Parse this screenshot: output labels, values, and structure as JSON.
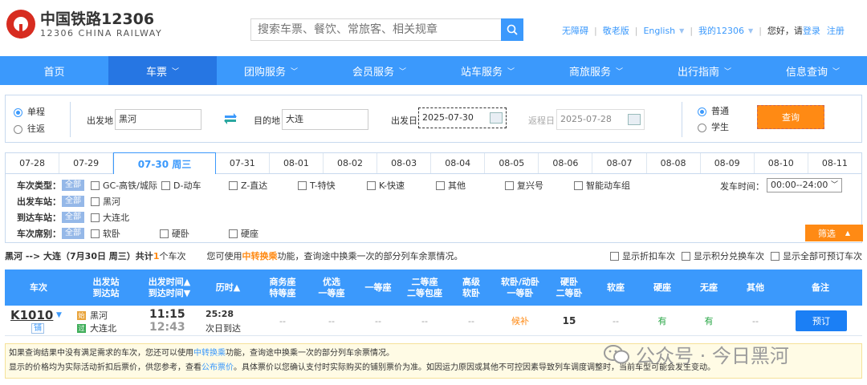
{
  "header": {
    "logo_cn": "中国铁路12306",
    "logo_en": "12306 CHINA RAILWAY",
    "search_placeholder": "搜索车票、餐饮、常旅客、相关规章",
    "links": [
      "无障碍",
      "敬老版",
      "English",
      "我的12306"
    ],
    "greeting": "您好，请",
    "login": "登录",
    "register": "注册"
  },
  "nav": [
    "首页",
    "车票",
    "团购服务",
    "会员服务",
    "站车服务",
    "商旅服务",
    "出行指南",
    "信息查询"
  ],
  "query": {
    "oneway": "单程",
    "roundtrip": "往返",
    "from_label": "出发地",
    "from_value": "黑河",
    "to_label": "目的地",
    "to_value": "大连",
    "depart_label": "出发日",
    "depart_value": "2025-07-30",
    "return_label": "返程日",
    "return_value": "2025-07-28",
    "normal": "普通",
    "student": "学生",
    "query_btn": "查询"
  },
  "dates": [
    "07-28",
    "07-29",
    "07-30 周三",
    "07-31",
    "08-01",
    "08-02",
    "08-03",
    "08-04",
    "08-05",
    "08-06",
    "08-07",
    "08-08",
    "08-09",
    "08-10",
    "08-11"
  ],
  "filter": {
    "type_label": "车次类型：",
    "all": "全部",
    "types": [
      "GC-高铁/城际",
      "D-动车",
      "Z-直达",
      "T-特快",
      "K-快速",
      "其他",
      "复兴号",
      "智能动车组"
    ],
    "from_label": "出发车站：",
    "from_station": "黑河",
    "to_label": "到达车站：",
    "to_station": "大连北",
    "seat_label": "车次席别：",
    "seats": [
      "软卧",
      "硬卧",
      "硬座"
    ],
    "time_label": "发车时间：",
    "time_value": "00:00--24:00",
    "filter_btn": "筛选"
  },
  "summary": {
    "route": "黑河 --> 大连（7月30日 周三）共计",
    "count": "1",
    "count_suffix": "个车次",
    "tip_pre": "您可使用",
    "tip_link": "中转换乘",
    "tip_post": "功能，查询途中换乘一次的部分列车余票情况。",
    "opt1": "显示折扣车次",
    "opt2": "显示积分兑换车次",
    "opt3": "显示全部可预订车次"
  },
  "table": {
    "headers": {
      "train": "车次",
      "stations_1": "出发站",
      "stations_2": "到达站",
      "times_1": "出发时间▲",
      "times_2": "到达时间▼",
      "duration": "历时▲",
      "business_1": "商务座",
      "business_2": "特等座",
      "premium_1": "优选",
      "premium_2": "一等座",
      "first": "一等座",
      "second_1": "二等座",
      "second_2": "二等包座",
      "deluxe_1": "高级",
      "deluxe_2": "软卧",
      "soft1_1": "软卧/动卧",
      "soft1_2": "一等卧",
      "hard2_1": "硬卧",
      "hard2_2": "二等卧",
      "soft_seat": "软座",
      "hard_seat": "硬座",
      "no_seat": "无座",
      "other": "其他",
      "remark": "备注"
    },
    "row": {
      "train": "K1010",
      "tag": "铺",
      "from": "黑河",
      "to": "大连北",
      "depart": "11:15",
      "arrive": "12:43",
      "duration": "25:28",
      "arrive_day": "次日到达",
      "business": "--",
      "premium": "--",
      "first": "--",
      "second": "--",
      "deluxe": "--",
      "soft_sleeper": "候补",
      "hard_sleeper": "15",
      "soft_seat": "--",
      "hard_seat": "有",
      "no_seat": "有",
      "other": "--",
      "book": "预订"
    }
  },
  "notice": {
    "line1_pre": "如果查询结果中没有满足需求的车次，您还可以使用",
    "line1_link": "中转换乘",
    "line1_post": "功能，查询途中换乘一次的部分列车余票情况。",
    "line2_pre": "显示的价格均为实际活动折扣后票价，供您参考，查看",
    "line2_link": "公布票价",
    "line2_post": "。具体票价以您确认支付时实际购买的铺别票价为准。如因运力原因或其他不可控因素导致列车调度调整时，当前车型可能会发生变动。"
  },
  "watermark": "公众号 · 今日黑河",
  "colors": {
    "primary": "#3b99fc",
    "accent": "#ff8a14",
    "nav_active": "#2676e3",
    "logo_red": "#d72c20"
  }
}
